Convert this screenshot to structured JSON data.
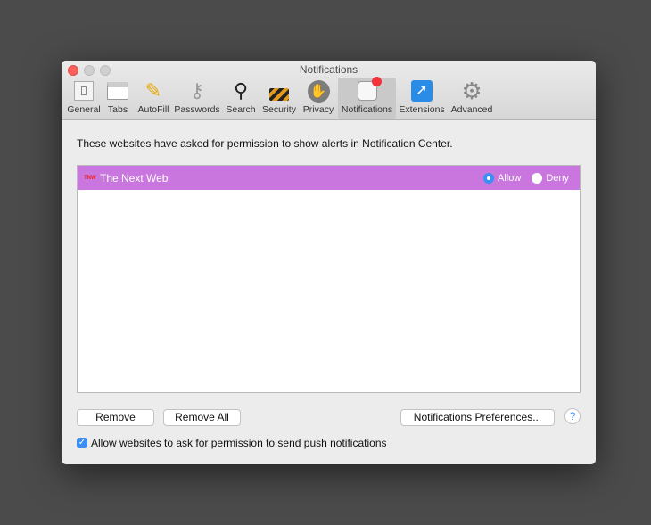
{
  "window": {
    "title": "Notifications"
  },
  "toolbar": {
    "items": [
      {
        "label": "General",
        "icon": "switch-icon"
      },
      {
        "label": "Tabs",
        "icon": "tabs-icon"
      },
      {
        "label": "AutoFill",
        "icon": "pencil-icon"
      },
      {
        "label": "Passwords",
        "icon": "key-icon"
      },
      {
        "label": "Search",
        "icon": "magnifier-icon"
      },
      {
        "label": "Security",
        "icon": "lock-icon"
      },
      {
        "label": "Privacy",
        "icon": "hand-icon"
      },
      {
        "label": "Notifications",
        "icon": "notification-icon",
        "selected": true
      },
      {
        "label": "Extensions",
        "icon": "puzzle-compass-icon"
      },
      {
        "label": "Advanced",
        "icon": "gear-icon"
      }
    ]
  },
  "main": {
    "description": "These websites have asked for permission to show alerts in Notification Center.",
    "sites": [
      {
        "favicon": "TNW",
        "name": "The Next Web",
        "allow_label": "Allow",
        "deny_label": "Deny",
        "selected": "Allow"
      }
    ],
    "row_color": "#c976de",
    "remove_label": "Remove",
    "remove_all_label": "Remove All",
    "prefs_label": "Notifications Preferences...",
    "help_label": "?",
    "checkbox_label": "Allow websites to ask for permission to send push notifications",
    "checkbox_checked": true
  }
}
